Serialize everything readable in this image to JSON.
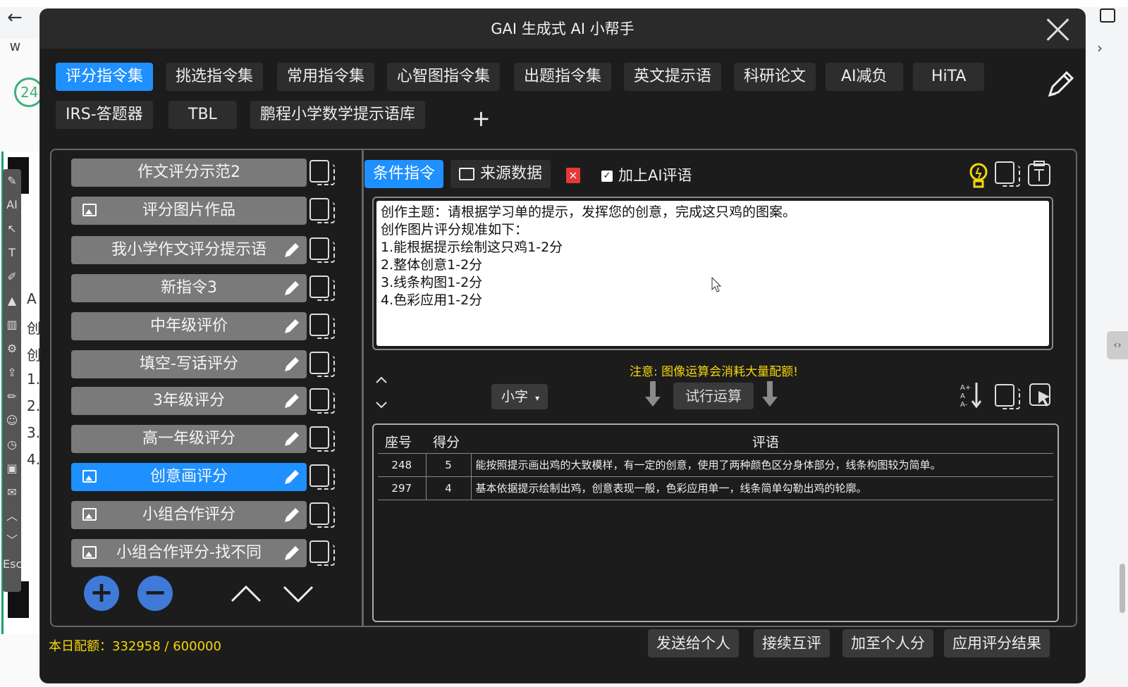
{
  "window": {
    "title": "GAI 生成式 AI 小帮手"
  },
  "background": {
    "circle_text": "24",
    "w_text": "W",
    "side_letters": [
      "A",
      "创",
      "创",
      "1.",
      "2.",
      "3.",
      "4."
    ]
  },
  "tabs": [
    {
      "label": "评分指令集",
      "active": true
    },
    {
      "label": "挑选指令集"
    },
    {
      "label": "常用指令集"
    },
    {
      "label": "心智图指令集"
    },
    {
      "label": "出题指令集"
    },
    {
      "label": "英文提示语"
    },
    {
      "label": "科研论文"
    },
    {
      "label": "AI减负"
    },
    {
      "label": "HiTA"
    },
    {
      "label": "IRS-答题器"
    },
    {
      "label": "TBL"
    },
    {
      "label": "鹏程小学数学提示语库"
    }
  ],
  "tab_add": "+",
  "command_list": [
    {
      "label": "作文评分示范2",
      "image": false,
      "editable": false
    },
    {
      "label": "评分图片作品",
      "image": true,
      "editable": false
    },
    {
      "label": "我小学作文评分提示语",
      "image": false,
      "editable": true
    },
    {
      "label": "新指令3",
      "image": false,
      "editable": true
    },
    {
      "label": "中年级评价",
      "image": false,
      "editable": true
    },
    {
      "label": "填空-写话评分",
      "image": false,
      "editable": true
    },
    {
      "label": "3年级评分",
      "image": false,
      "editable": true
    },
    {
      "label": "高一年级评分",
      "image": false,
      "editable": true
    },
    {
      "label": "创意画评分",
      "image": true,
      "editable": true,
      "active": true
    },
    {
      "label": "小组合作评分",
      "image": true,
      "editable": true
    },
    {
      "label": "小组合作评分-找不同",
      "image": true,
      "editable": true
    }
  ],
  "list_controls": {
    "add": "+",
    "remove": "−"
  },
  "editor": {
    "segment_condition": "条件指令",
    "segment_source": "来源数据",
    "remove_mark": "×",
    "add_ai_comment": {
      "label": "加上AI评语",
      "checked": true
    },
    "prompt_text": "创作主题：请根据学习单的提示，发挥您的创意，完成这只鸡的图案。\n创作图片评分规准如下：\n1.能根据提示绘制这只鸡1-2分\n2.整体创意1-2分\n3.线条构图1-2分\n4.色彩应用1-2分",
    "warning": "注意: 图像运算会消耗大量配额!",
    "font_size_select": "小字",
    "run_button": "试行运算"
  },
  "results": {
    "headers": [
      "座号",
      "得分",
      "评语"
    ],
    "rows": [
      {
        "seat": "248",
        "score": "5",
        "comment": "能按照提示画出鸡的大致模样，有一定的创意，使用了两种颜色区分身体部分，线条构图较为简单。"
      },
      {
        "seat": "297",
        "score": "4",
        "comment": "基本依据提示绘制出鸡，创意表现一般，色彩应用单一，线条简单勾勒出鸡的轮廓。"
      }
    ]
  },
  "footer": {
    "quota": "本日配额：332958 / 600000",
    "buttons": [
      "发送给个人",
      "接续互评",
      "加至个人分",
      "应用评分结果"
    ]
  },
  "colors": {
    "accent": "#1e90ff",
    "warning": "#f5d60a",
    "danger": "#e53935",
    "dialog_bg": "#1c1c1c"
  }
}
